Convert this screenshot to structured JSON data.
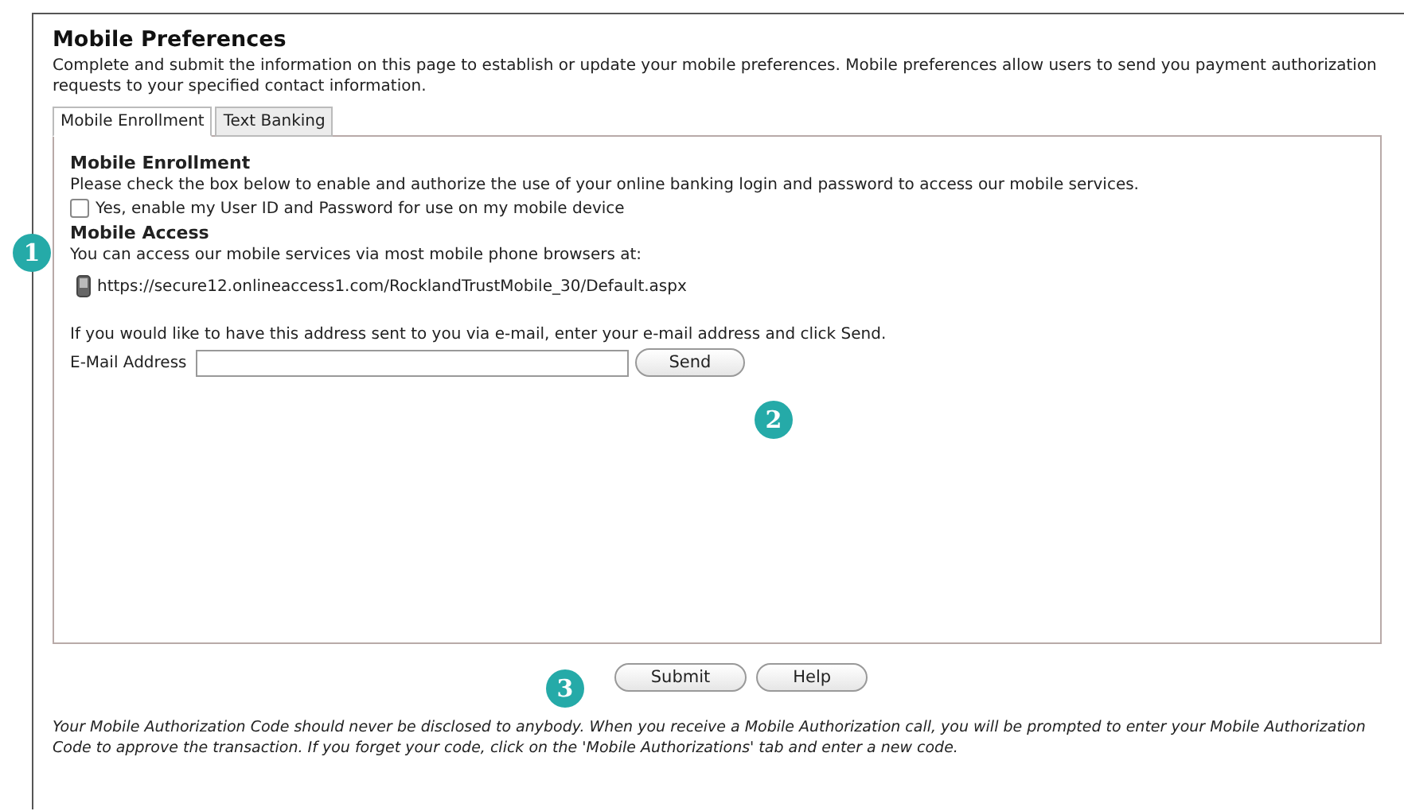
{
  "title": "Mobile Preferences",
  "intro": "Complete and submit the information on this page to establish or update your mobile preferences. Mobile preferences allow users to send you payment authorization requests to your specified contact information.",
  "tabs": [
    {
      "label": "Mobile Enrollment",
      "selected": true
    },
    {
      "label": "Text Banking",
      "selected": false
    }
  ],
  "enrollment": {
    "heading": "Mobile Enrollment",
    "text": "Please check the box below to enable and authorize the use of your online banking login and password to access our mobile services.",
    "checkbox": {
      "label": "Yes, enable my User ID and Password for use on my mobile device",
      "checked": false
    }
  },
  "access": {
    "heading": "Mobile Access",
    "text": "You can access our mobile services via most mobile phone browsers at:",
    "url": "https://secure12.onlineaccess1.com/RocklandTrustMobile_30/Default.aspx",
    "email_text": "If you would like to have this address sent to you via e-mail, enter your e-mail address and click Send.",
    "email_label": "E-Mail Address",
    "send_button": "Send"
  },
  "buttons": [
    "Submit",
    "Help"
  ],
  "footer": "Your Mobile Authorization Code should never be disclosed to anybody. When you receive a Mobile Authorization call, you will be prompted to enter your Mobile Authorization Code to approve the transaction. If you forget your code, click on the 'Mobile Authorizations' tab and enter a new code.",
  "callouts": [
    "1",
    "2",
    "3"
  ]
}
